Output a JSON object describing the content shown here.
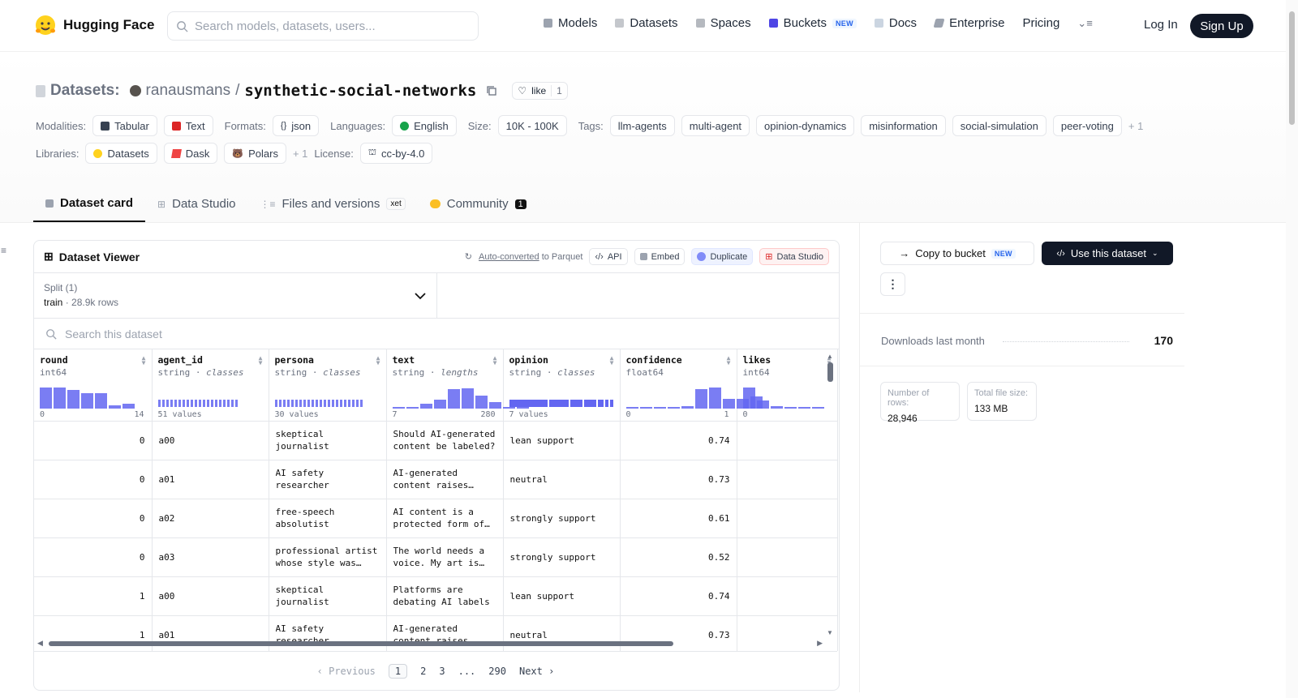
{
  "nav": {
    "brand": "Hugging Face",
    "search_placeholder": "Search models, datasets, users...",
    "links": [
      "Models",
      "Datasets",
      "Spaces",
      "Buckets",
      "Docs",
      "Enterprise",
      "Pricing"
    ],
    "new_badge": "NEW",
    "login": "Log In",
    "signup": "Sign Up"
  },
  "repo": {
    "type_label": "Datasets:",
    "owner": "ranausmans",
    "separator": "/",
    "name": "synthetic-social-networks",
    "like_label": "like",
    "like_count": "1"
  },
  "meta": {
    "modalities_label": "Modalities:",
    "modalities": [
      "Tabular",
      "Text"
    ],
    "formats_label": "Formats:",
    "formats": [
      "json"
    ],
    "languages_label": "Languages:",
    "languages": [
      "English"
    ],
    "size_label": "Size:",
    "size": "10K - 100K",
    "tags_label": "Tags:",
    "tags": [
      "llm-agents",
      "multi-agent",
      "opinion-dynamics",
      "misinformation",
      "social-simulation",
      "peer-voting"
    ],
    "tags_more": "+ 1",
    "libraries_label": "Libraries:",
    "libraries": [
      "Datasets",
      "Dask",
      "Polars"
    ],
    "libraries_more": "+ 1",
    "license_label": "License:",
    "license": "cc-by-4.0"
  },
  "tabs": [
    "Dataset card",
    "Data Studio",
    "Files and versions",
    "Community"
  ],
  "xet_badge": "xet",
  "community_count": "1",
  "viewer": {
    "title": "Dataset Viewer",
    "autoconv": "Auto-converted",
    "autoconv_suffix": "to Parquet",
    "buttons": [
      "API",
      "Embed",
      "Duplicate",
      "Data Studio"
    ],
    "split_label": "Split (1)",
    "split_value": "train",
    "split_rows": "28.9k rows",
    "search_placeholder": "Search this dataset",
    "columns": [
      {
        "name": "round",
        "type": "int64",
        "kind": "",
        "range_min": "0",
        "range_max": "14",
        "hist": [
          1,
          1,
          0.85,
          0.7,
          0.7,
          0.15,
          0.2
        ]
      },
      {
        "name": "agent_id",
        "type": "string",
        "kind": "classes",
        "range_min": "51 values",
        "range_max": ""
      },
      {
        "name": "persona",
        "type": "string",
        "kind": "classes",
        "range_min": "30 values",
        "range_max": ""
      },
      {
        "name": "text",
        "type": "string",
        "kind": "lengths",
        "range_min": "7",
        "range_max": "280",
        "hist": [
          0.03,
          0.05,
          0.2,
          0.4,
          0.9,
          0.95,
          0.6,
          0.3,
          0.06,
          0.04
        ]
      },
      {
        "name": "opinion",
        "type": "string",
        "kind": "classes",
        "range_min": "7 values",
        "range_max": ""
      },
      {
        "name": "confidence",
        "type": "float64",
        "kind": "",
        "range_min": "0",
        "range_max": "1",
        "hist": [
          0.03,
          0.03,
          0.02,
          0.05,
          0.1,
          0.9,
          1,
          0.45,
          0.45,
          0.55
        ]
      },
      {
        "name": "likes",
        "type": "int64",
        "kind": "",
        "range_min": "0",
        "range_max": "",
        "hist": [
          1,
          0.35,
          0.1,
          0.06,
          0.04,
          0.03
        ]
      }
    ],
    "rows": [
      [
        "0",
        "a00",
        "skeptical journalist",
        "Should AI-generated content be labeled?",
        "lean support",
        "0.74",
        ""
      ],
      [
        "0",
        "a01",
        "AI safety researcher",
        "AI-generated content raises concerns",
        "neutral",
        "0.73",
        ""
      ],
      [
        "0",
        "a02",
        "free-speech absolutist",
        "AI content is a protected form of expression",
        "strongly support",
        "0.61",
        ""
      ],
      [
        "0",
        "a03",
        "professional artist whose style was copied",
        "The world needs a voice. My art is mine",
        "strongly support",
        "0.52",
        ""
      ],
      [
        "1",
        "a00",
        "skeptical journalist",
        "Platforms are debating AI labels",
        "lean support",
        "0.74",
        ""
      ],
      [
        "1",
        "a01",
        "AI safety researcher",
        "AI-generated content raises concerns",
        "neutral",
        "0.73",
        ""
      ]
    ],
    "pager": {
      "prev": "Previous",
      "pages": [
        "1",
        "2",
        "3",
        "...",
        "290"
      ],
      "next": "Next"
    }
  },
  "side": {
    "copy_label": "Copy to bucket",
    "copy_badge": "NEW",
    "use_label": "Use this dataset",
    "downloads_label": "Downloads last month",
    "downloads": "170",
    "rows_label": "Number of rows:",
    "rows": "28,946",
    "size_label": "Total file size:",
    "size": "133 MB"
  }
}
